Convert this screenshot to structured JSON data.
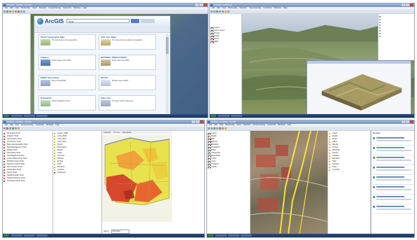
{
  "q1": {
    "window_title": "Untitled - ArcMap - ArcInfo",
    "arcgis_logo": "ArcGIS",
    "search_value": "world",
    "cards": [
      {
        "title": "World Topographic Map",
        "text": "This map features the topographic..."
      },
      {
        "title": "USA Topo Maps",
        "text": "This map provides seamless topographic..."
      },
      {
        "title": "Imagery",
        "text": "World imagery from ESRI..."
      },
      {
        "title": "NATIONAL WORLD MAPS",
        "text": "World maps from ESRI..."
      },
      {
        "title": "ESRI® Africa Base",
        "text": "Map of Africa ESRI..."
      },
      {
        "title": "Rhodes",
        "text": "Rhodes map by ESRI..."
      },
      {
        "title": "Population",
        "text": "World population density..."
      },
      {
        "title": "Fake Grid",
        "text": "This layer shows a fake grid..."
      }
    ]
  },
  "q2": {
    "window_title": "Untitled - ArcScene",
    "toc": [
      "Layers",
      "Scene layers",
      "Terrain",
      "Roads",
      "Rivers",
      "DEM"
    ]
  },
  "q3": {
    "window_title": "Untitled - ArcMap - ArcInfo",
    "tabs": [
      "Contents",
      "Preview",
      "Description"
    ],
    "toolbox": [
      "3D Analyst Tools",
      "Analysis Tools",
      "Cartography Tools",
      "Conversion Tools",
      "Data Interoperability Tools",
      "Data Management Tools",
      "Editing Tools",
      "Geocoding Tools",
      "Geostatistical Analyst",
      "Linear Referencing Tools",
      "Multidimension Tools",
      "Network Analyst Tools",
      "Parcel Fabric Tools",
      "Schematics Tools",
      "Server Tools",
      "Spatial Analyst Tools",
      "Spatial Statistics Tools",
      "Tracking Analyst Tools"
    ],
    "catalog": [
      "Layers_2008",
      "Land_2009",
      "Land_2010",
      "Land_2011",
      "Rivers",
      "Boundaries",
      "Roads",
      "Cities",
      "Counties",
      "Parcels",
      "Zoning",
      "Soils",
      "Elevation",
      "Landuse",
      "Toolboxes"
    ],
    "name_label": "Name:",
    "name_value": "Subregion"
  },
  "q4": {
    "window_title": "Untitled - ArcMap - ArcInfo",
    "toc": [
      "Layers",
      "Roads",
      "Rail",
      "Parcels",
      "Buildings",
      "Vegetation",
      "Water",
      "Orthophoto",
      "Boundaries",
      "Points",
      "Lines",
      "Polygons",
      "Labels"
    ],
    "catalog": [
      "Layers",
      "Roads",
      "Rivers",
      "Lakes",
      "Parcels",
      "Zoning",
      "Buildings",
      "Streets",
      "Landuse",
      "Elevation",
      "Soils",
      "Geology",
      "Cities",
      "Counties"
    ],
    "results_title": "Results"
  }
}
